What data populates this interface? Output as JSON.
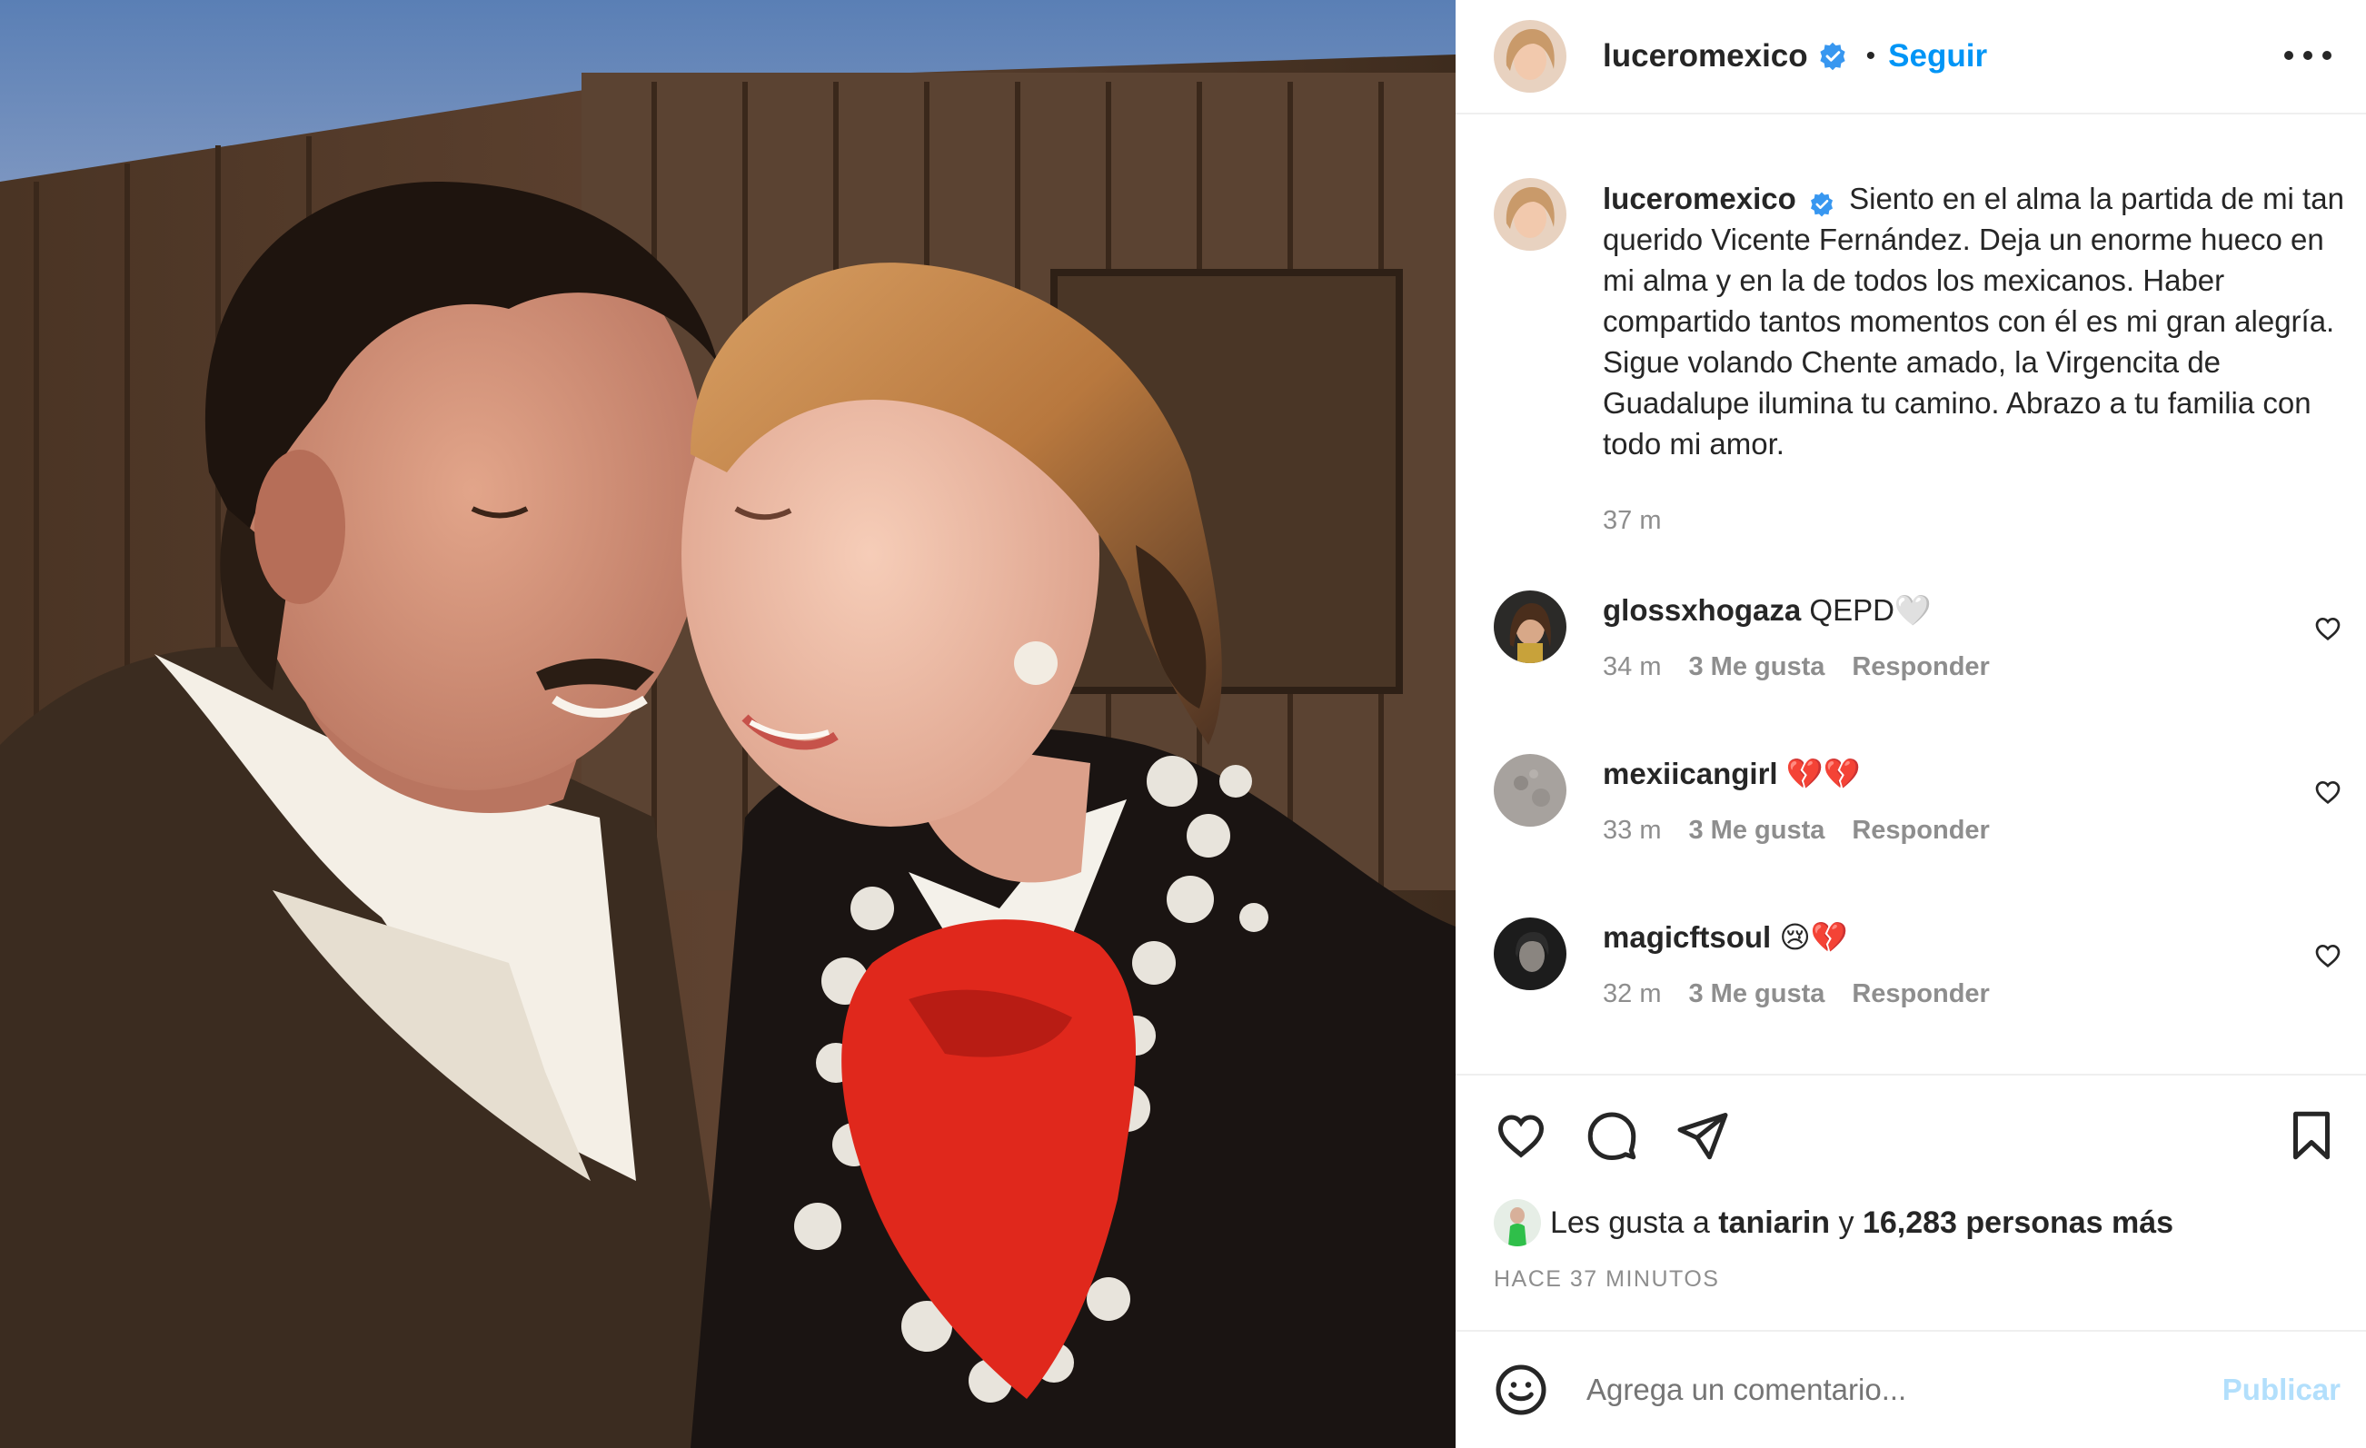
{
  "post": {
    "author": "luceromexico",
    "follow_label": "Seguir",
    "separator": "•",
    "caption_author": "luceromexico",
    "caption_text": "Siento en el alma la partida de mi tan querido Vicente Fernández. Deja un enorme hueco en mi alma y en la de todos los mexicanos. Haber compartido tantos momentos con él es mi gran alegría. Sigue volando Chente amado, la Virgencita de Guadalupe ilumina tu camino. Abrazo a tu familia con todo mi amor.",
    "caption_time": "37 m"
  },
  "comments": [
    {
      "user": "glossxhogaza",
      "text": "QEPD🤍",
      "time": "34 m",
      "likes": "3 Me gusta",
      "reply": "Responder"
    },
    {
      "user": "mexiicangirl",
      "text": "💔💔",
      "time": "33 m",
      "likes": "3 Me gusta",
      "reply": "Responder"
    },
    {
      "user": "magicftsoul",
      "text": "😢💔",
      "time": "32 m",
      "likes": "3 Me gusta",
      "reply": "Responder"
    }
  ],
  "likes": {
    "prefix": "Les gusta a",
    "user": "taniarin",
    "connector": "y",
    "others": "16,283 personas más"
  },
  "timestamp": "HACE 37 MINUTOS",
  "add_comment": {
    "placeholder": "Agrega un comentario...",
    "post_label": "Publicar"
  },
  "icons": {
    "verified": "verified-badge-icon",
    "more": "more-options-icon",
    "like": "heart-icon",
    "comment": "comment-bubble-icon",
    "share": "paper-plane-icon",
    "save": "bookmark-icon",
    "emoji": "emoji-icon"
  },
  "colors": {
    "accent": "#0095f6",
    "verified": "#3897f0",
    "muted": "#8e8e8e",
    "post_disabled": "#b2dffc"
  }
}
